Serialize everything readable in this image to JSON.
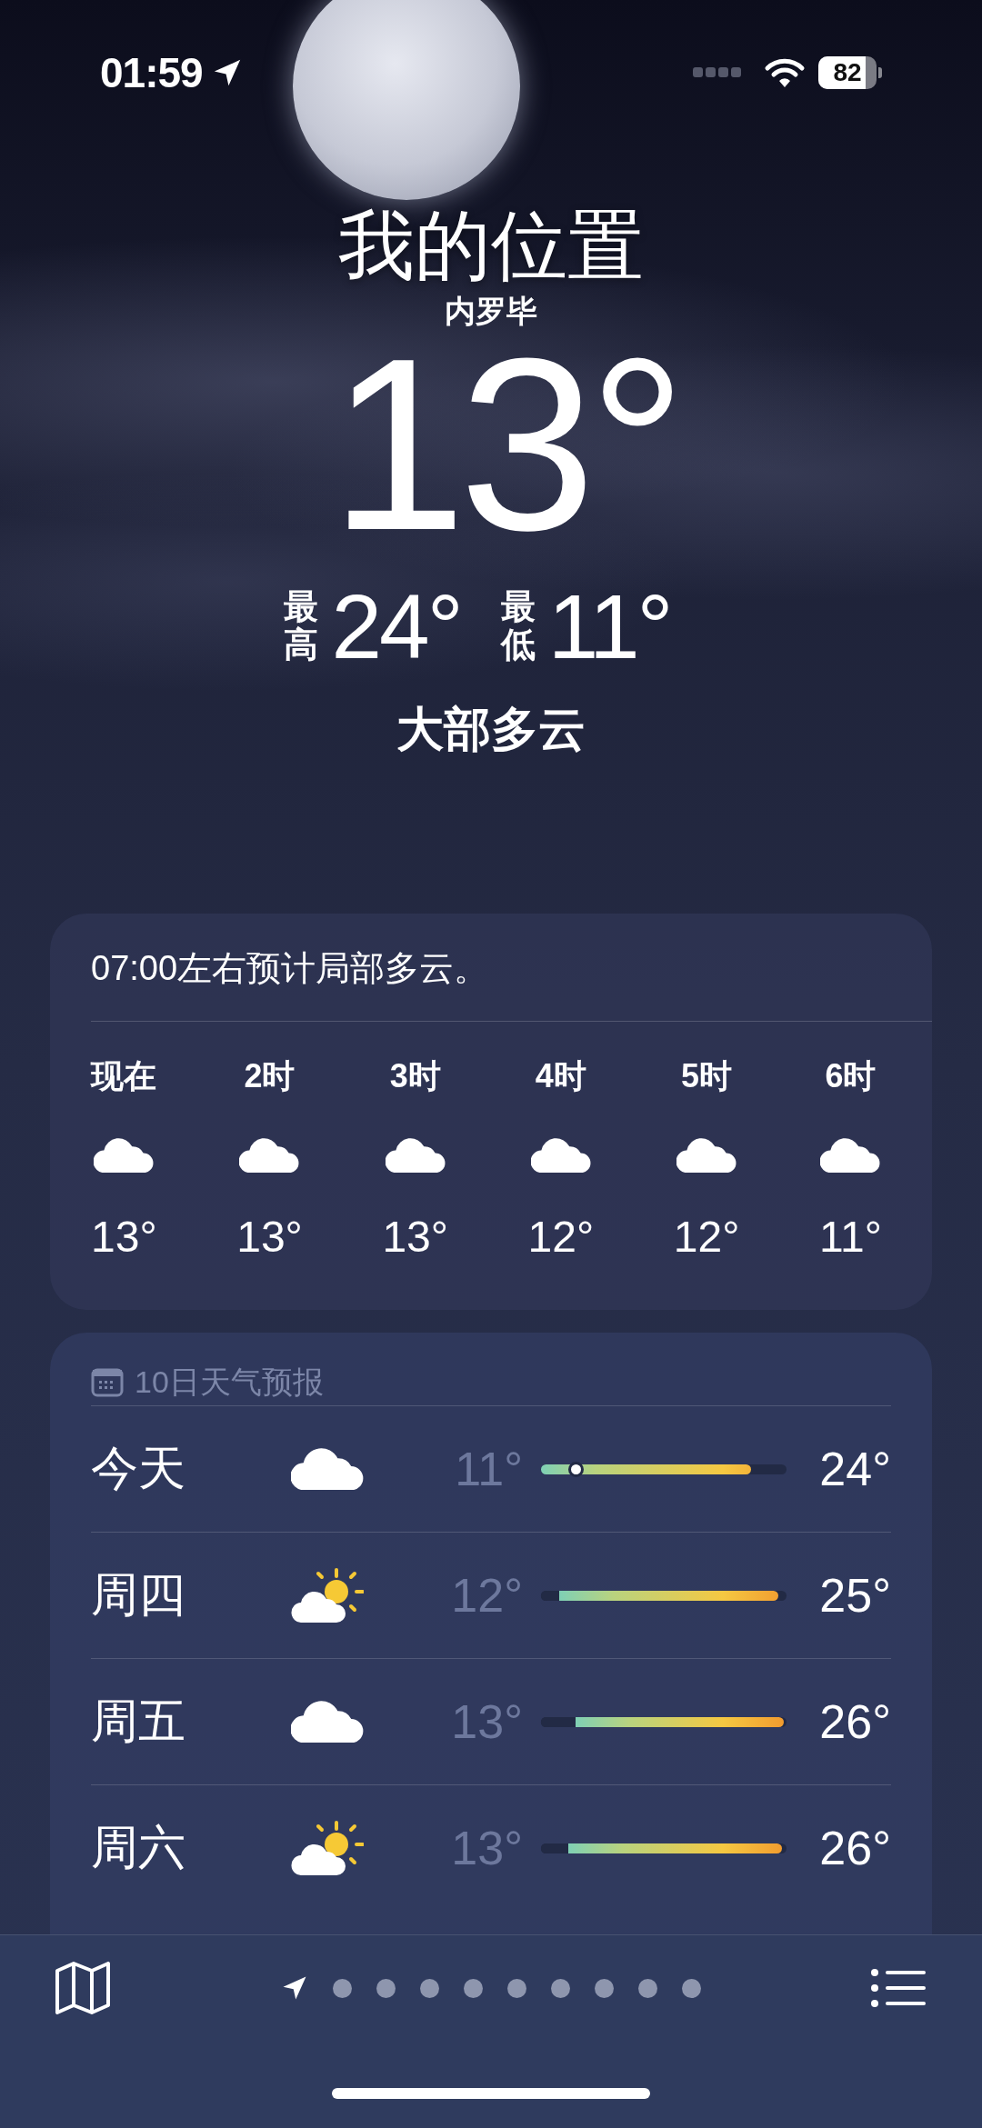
{
  "status_bar": {
    "time": "01:59",
    "battery": {
      "text": "82",
      "level": 0.82
    }
  },
  "location": {
    "title": "我的位置",
    "place": "内罗毕",
    "temperature": "13°",
    "high_label": "最高",
    "high": "24°",
    "low_label": "最低",
    "low": "11°",
    "condition": "大部多云"
  },
  "hourly": {
    "summary": "07:00左右预计局部多云。",
    "hours": [
      {
        "time": "现在",
        "kind": "cloud",
        "temp": "13°"
      },
      {
        "time": "2时",
        "kind": "cloud",
        "temp": "13°"
      },
      {
        "time": "3时",
        "kind": "cloud",
        "temp": "13°"
      },
      {
        "time": "4时",
        "kind": "cloud",
        "temp": "12°"
      },
      {
        "time": "5时",
        "kind": "cloud",
        "temp": "12°"
      },
      {
        "time": "6时",
        "kind": "cloud",
        "temp": "11°"
      }
    ]
  },
  "daily": {
    "title": "10日天气预报",
    "days": [
      {
        "day": "今天",
        "kind": "cloud",
        "low": "11°",
        "high": "24°",
        "bar_end": {
          "level": 0.855
        },
        "now_marker": {
          "level": 0.14
        }
      },
      {
        "day": "周四",
        "kind": "sun_cloud",
        "low": "12°",
        "high": "25°",
        "bar_start": {
          "level": 0.075
        },
        "bar_end": {
          "level": 0.966
        }
      },
      {
        "day": "周五",
        "kind": "cloud",
        "low": "13°",
        "high": "26°",
        "bar_start": {
          "level": 0.14
        },
        "bar_end": {
          "level": 0.99
        }
      },
      {
        "day": "周六",
        "kind": "sun_cloud",
        "low": "13°",
        "high": "26°",
        "bar_start": {
          "level": 0.11
        },
        "bar_end": {
          "level": 0.98
        }
      }
    ]
  },
  "tab_bar": {
    "pages": [
      {
        "kind": "location",
        "selected": true
      },
      {
        "kind": "dot",
        "selected": false
      },
      {
        "kind": "dot",
        "selected": false
      },
      {
        "kind": "dot",
        "selected": false
      },
      {
        "kind": "dot",
        "selected": false
      },
      {
        "kind": "dot",
        "selected": false
      },
      {
        "kind": "dot",
        "selected": false
      },
      {
        "kind": "dot",
        "selected": false
      },
      {
        "kind": "dot",
        "selected": false
      },
      {
        "kind": "dot",
        "selected": false
      }
    ]
  }
}
